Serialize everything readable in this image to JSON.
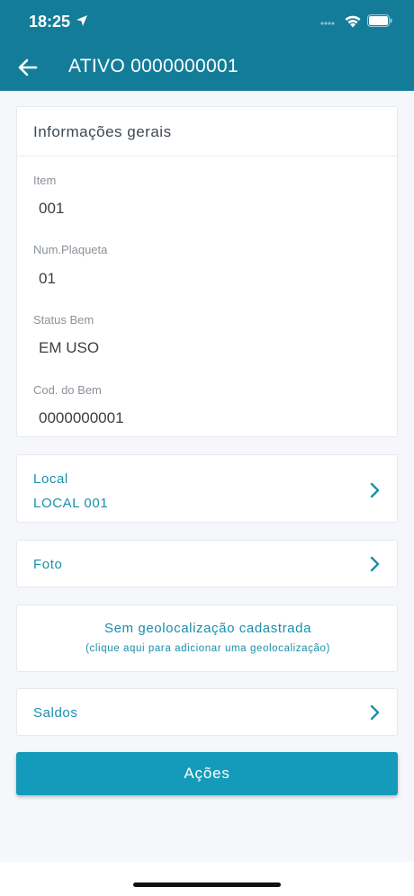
{
  "status_bar": {
    "time": "18:25",
    "icons": [
      "location-arrow-icon",
      "signal-dots-icon",
      "wifi-icon",
      "battery-icon"
    ]
  },
  "header": {
    "title": "ATIVO 0000000001",
    "back_icon": "arrow-left-icon",
    "background": "#137d99"
  },
  "general_info": {
    "title": "Informações gerais",
    "fields": [
      {
        "label": "Item",
        "value": "001"
      },
      {
        "label": "Num.Plaqueta",
        "value": "01"
      },
      {
        "label": "Status Bem",
        "value": "EM USO"
      },
      {
        "label": "Cod. do Bem",
        "value": "0000000001"
      }
    ]
  },
  "local": {
    "label": "Local",
    "value": "LOCAL 001"
  },
  "foto": {
    "label": "Foto"
  },
  "geolocation": {
    "title": "Sem geolocalização cadastrada",
    "subtitle": "(clique aqui para adicionar uma geolocalização)"
  },
  "saldos": {
    "label": "Saldos"
  },
  "actions": {
    "label": "Ações"
  },
  "colors": {
    "accent": "#1a8fab",
    "button": "#149bbb",
    "text_value": "#3a3f45",
    "text_label": "#8a9199"
  }
}
